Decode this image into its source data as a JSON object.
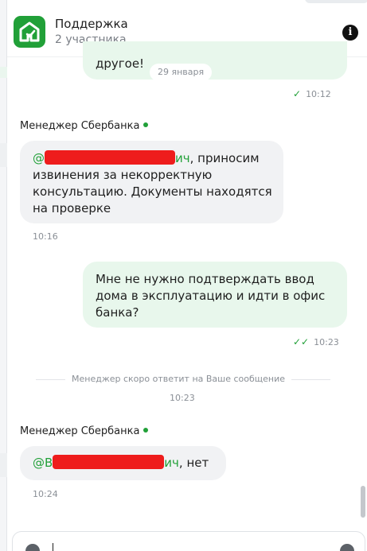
{
  "header": {
    "title": "Поддержка",
    "subtitle": "2 участника",
    "logo_icon": "sber-home-logo-icon",
    "info_icon": "info-icon"
  },
  "messages": {
    "m1": {
      "text": "другое!",
      "date_label": "29 января",
      "time": "10:12"
    },
    "m2": {
      "sender": "Менеджер Сбербанка",
      "mention_prefix": "@",
      "mention_suffix": "ич",
      "line1_rest": ", приносим",
      "line2": "извинения за некорректную",
      "line3": "консультацию. Документы находятся",
      "line4": "на проверке",
      "time": "10:16"
    },
    "m3": {
      "line1": "Мне не нужно подтверждать ввод",
      "line2": "дома в эксплуатацию и идти в офис",
      "line3": "банка?",
      "time": "10:23"
    },
    "system": {
      "text": "Менеджер скоро ответит на Ваше сообщение",
      "time": "10:23"
    },
    "m4": {
      "sender": "Менеджер Сбербанка",
      "mention_prefix": "@В",
      "mention_suffix": "ич",
      "rest": ", нет",
      "time": "10:24"
    }
  },
  "composer": {
    "attach_icon": "attach-icon",
    "emoji_icon": "emoji-icon"
  },
  "colors": {
    "accent": "#21a038",
    "outgoing_bubble": "#e8f7ec",
    "incoming_bubble": "#f1f2f4",
    "redaction": "#ee1c1c"
  }
}
